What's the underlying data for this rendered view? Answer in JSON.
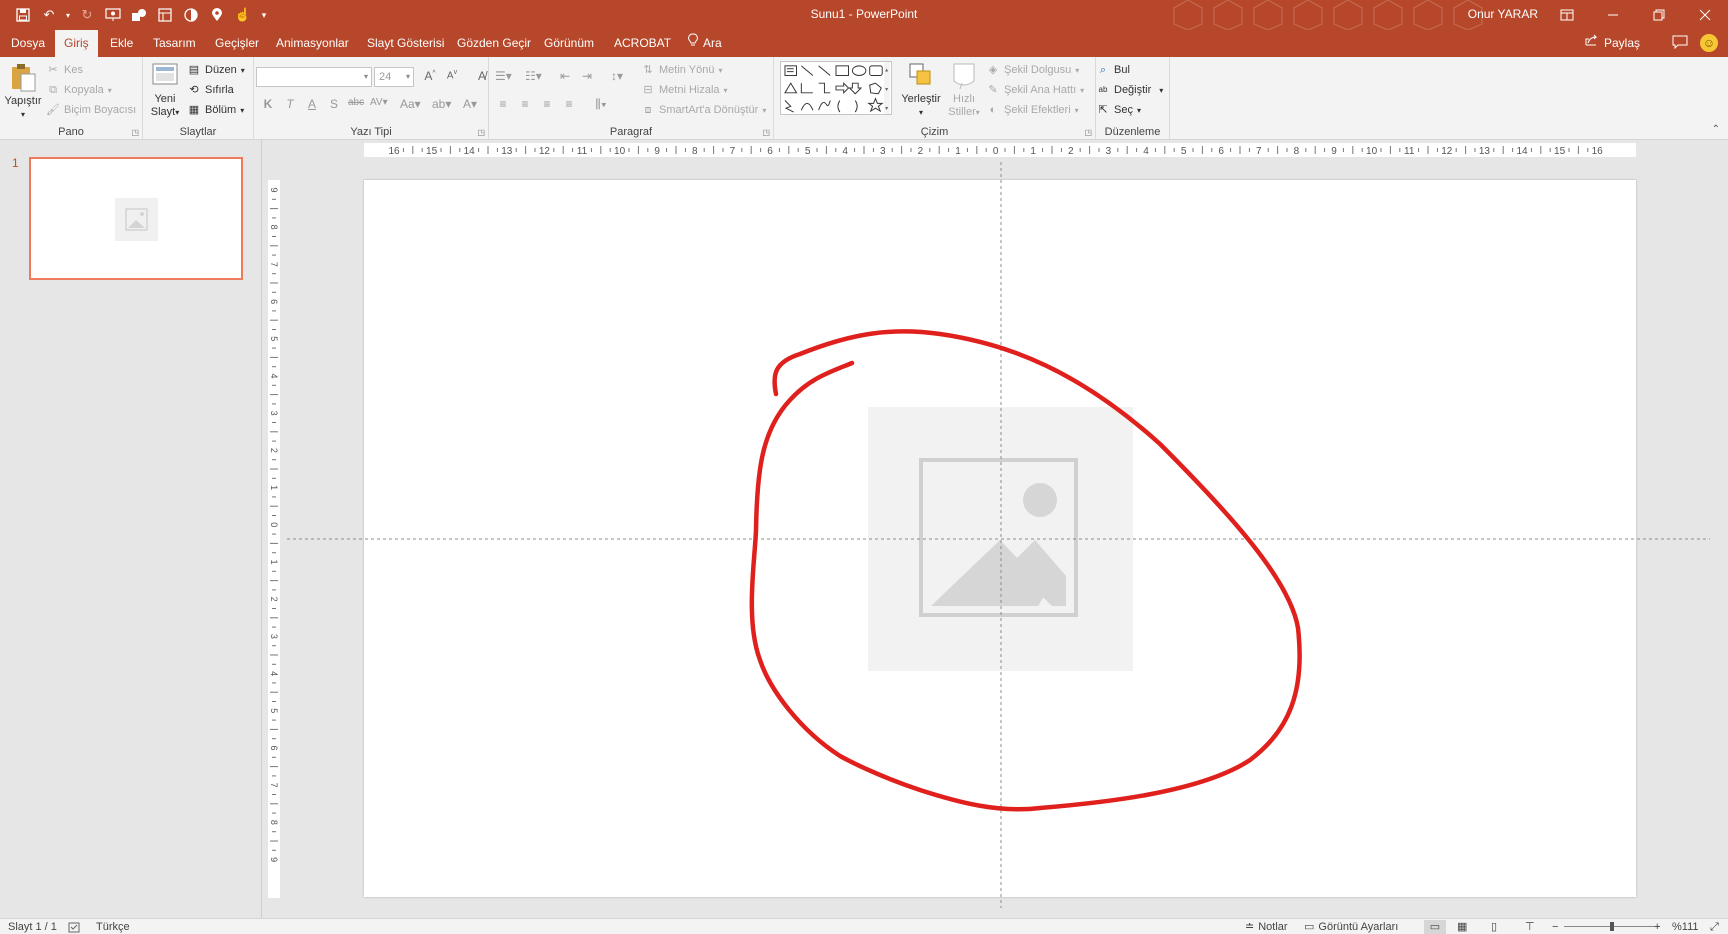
{
  "window": {
    "doc_name": "Sunu1",
    "separator": "-",
    "app_name": "PowerPoint",
    "user": "Onur YARAR",
    "accent_color": "#b7472a"
  },
  "quick_access": [
    "save-icon",
    "undo-icon",
    "redo-icon",
    "from-beginning-icon",
    "shapes-icon",
    "layout-icon",
    "contrast-icon",
    "location-pin-icon",
    "touch-mode-icon",
    "customize-qat-icon"
  ],
  "tabs": [
    {
      "label": "Dosya"
    },
    {
      "label": "Giriş",
      "active": true
    },
    {
      "label": "Ekle"
    },
    {
      "label": "Tasarım"
    },
    {
      "label": "Geçişler"
    },
    {
      "label": "Animasyonlar"
    },
    {
      "label": "Slayt Gösterisi"
    },
    {
      "label": "Gözden Geçir"
    },
    {
      "label": "Görünüm"
    },
    {
      "label": "ACROBAT"
    }
  ],
  "tell_me": "Ara",
  "share": "Paylaş",
  "ribbon": {
    "clipboard": {
      "label": "Pano",
      "paste": "Yapıştır",
      "cut": "Kes",
      "copy": "Kopyala",
      "format_painter": "Biçim Boyacısı"
    },
    "slides": {
      "label": "Slaytlar",
      "new_slide_line1": "Yeni",
      "new_slide_line2": "Slayt",
      "layout": "Düzen",
      "reset": "Sıfırla",
      "section": "Bölüm"
    },
    "font": {
      "label": "Yazı Tipi",
      "font_name": "",
      "font_size": "24"
    },
    "paragraph": {
      "label": "Paragraf",
      "text_direction": "Metin Yönü",
      "align_text": "Metni Hizala",
      "smartart": "SmartArt'a Dönüştür"
    },
    "drawing": {
      "label": "Çizim",
      "arrange": "Yerleştir",
      "quick_styles_line1": "Hızlı",
      "quick_styles_line2": "Stiller",
      "shape_fill": "Şekil Dolgusu",
      "shape_outline": "Şekil Ana Hattı",
      "shape_effects": "Şekil Efektleri"
    },
    "editing": {
      "label": "Düzenleme",
      "find": "Bul",
      "replace": "Değiştir",
      "select": "Seç"
    }
  },
  "thumbnails": [
    {
      "number": "1"
    }
  ],
  "ruler": {
    "horizontal_labels": [
      "16",
      "15",
      "14",
      "13",
      "12",
      "11",
      "10",
      "9",
      "8",
      "7",
      "6",
      "5",
      "4",
      "3",
      "2",
      "1",
      "0",
      "1",
      "2",
      "3",
      "4",
      "5",
      "6",
      "7",
      "8",
      "9",
      "10",
      "11",
      "12",
      "13",
      "14",
      "15",
      "16"
    ],
    "vertical_labels": [
      "9",
      "8",
      "7",
      "6",
      "5",
      "4",
      "3",
      "2",
      "1",
      "0",
      "1",
      "2",
      "3",
      "4",
      "5",
      "6",
      "7",
      "8",
      "9"
    ]
  },
  "annotation": {
    "color": "#e0201c",
    "shape": "freehand-circle"
  },
  "status": {
    "slide_info": "Slayt 1 / 1",
    "language": "Türkçe",
    "notes": "Notlar",
    "display_settings": "Görüntü Ayarları",
    "zoom": "%111",
    "zoom_level": 0.5
  }
}
